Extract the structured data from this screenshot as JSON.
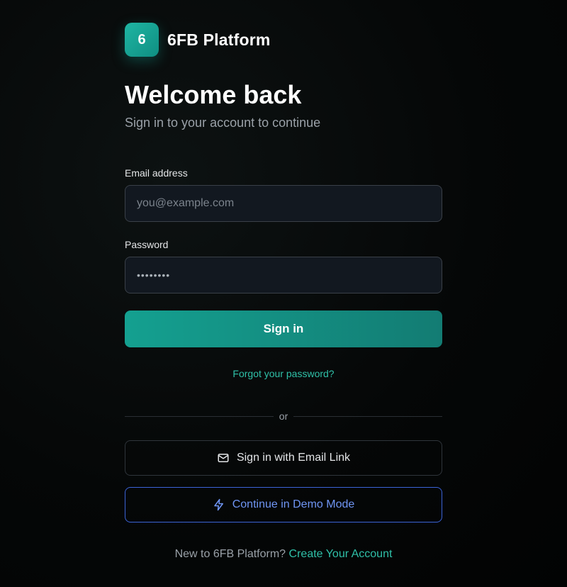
{
  "brand": {
    "logo_text": "6",
    "name": "6FB Platform",
    "accent": "#14a090"
  },
  "heading": {
    "title": "Welcome back",
    "subtitle": "Sign in to your account to continue"
  },
  "form": {
    "email_label": "Email address",
    "email_placeholder": "you@example.com",
    "email_value": "",
    "password_label": "Password",
    "password_value": "••••••••",
    "submit_label": "Sign in"
  },
  "forgot_link": "Forgot your password?",
  "divider_text": "or",
  "email_link_button": {
    "label": "Sign in with Email Link",
    "icon": "mail-icon"
  },
  "demo_button": {
    "label": "Continue in Demo Mode",
    "icon": "lightning-icon",
    "color": "#6f95f4"
  },
  "signup": {
    "prompt": "New to 6FB Platform?",
    "link": "Create Your Account"
  }
}
